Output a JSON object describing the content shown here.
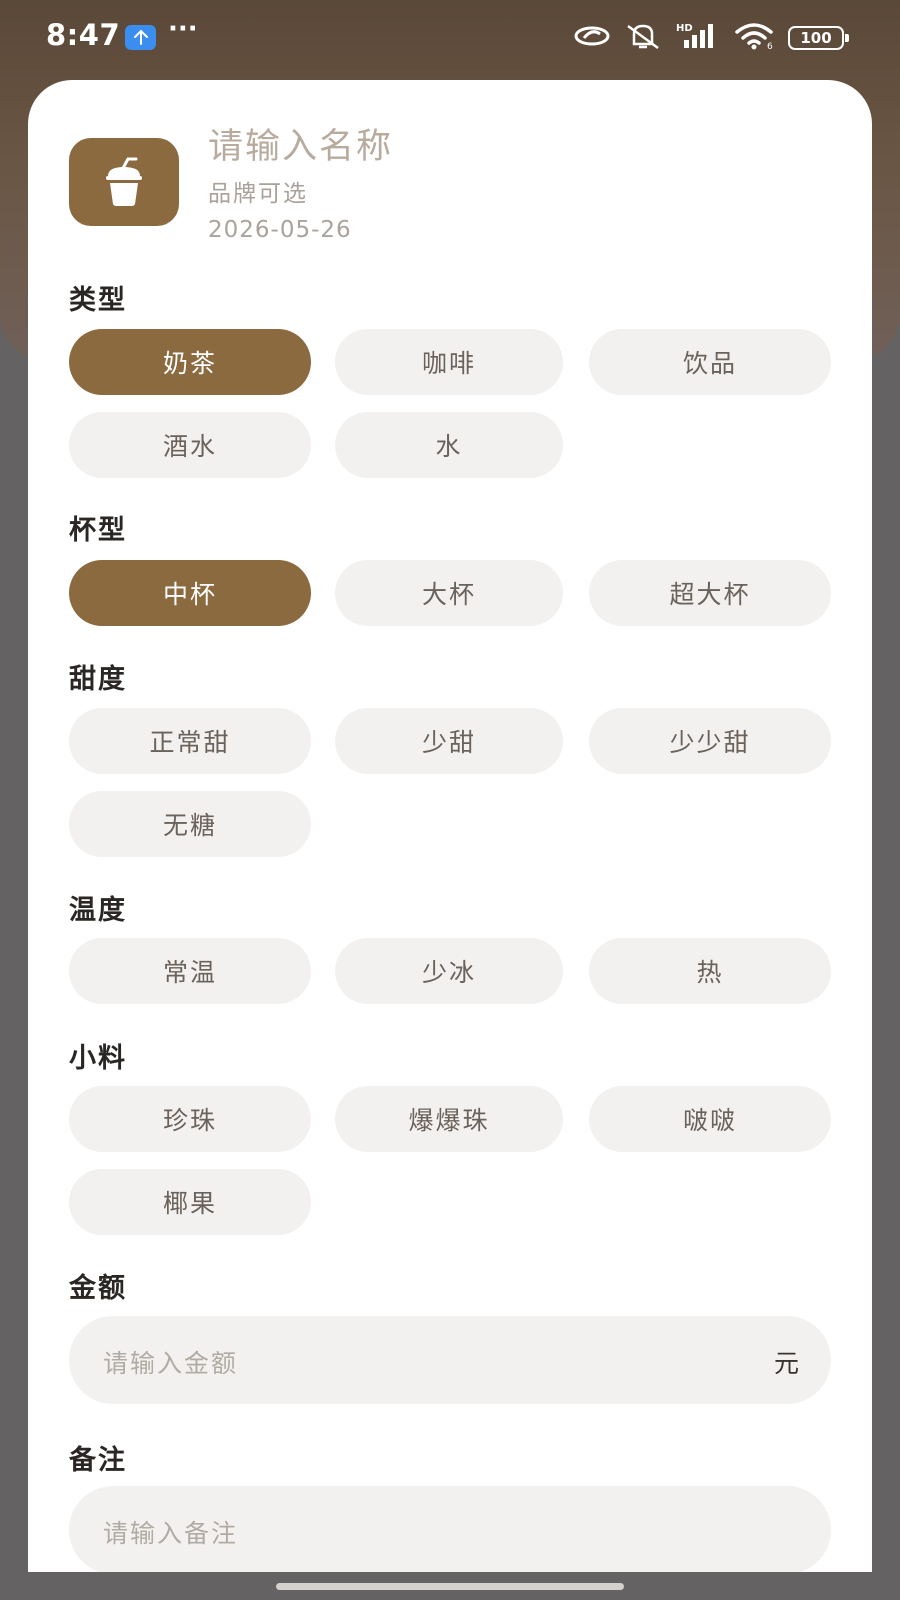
{
  "status_bar": {
    "time": "8:47",
    "dots": "···",
    "battery": "100",
    "icons": [
      "upload-notification-icon",
      "link-icon",
      "bell-muted-icon",
      "hd-signal-icon",
      "wifi-icon",
      "battery-icon"
    ]
  },
  "header": {
    "name_placeholder": "请输入名称",
    "brand_placeholder": "品牌可选",
    "date": "2026-05-26",
    "icon": "drink-cup-icon",
    "accent_color": "#8c6a40"
  },
  "sections": {
    "type": {
      "title": "类型",
      "options": [
        "奶茶",
        "咖啡",
        "饮品",
        "酒水",
        "水"
      ],
      "selected": "奶茶"
    },
    "cup": {
      "title": "杯型",
      "options": [
        "中杯",
        "大杯",
        "超大杯"
      ],
      "selected": "中杯"
    },
    "sweetness": {
      "title": "甜度",
      "options": [
        "正常甜",
        "少甜",
        "少少甜",
        "无糖"
      ],
      "selected": ""
    },
    "temperature": {
      "title": "温度",
      "options": [
        "常温",
        "少冰",
        "热"
      ],
      "selected": ""
    },
    "toppings": {
      "title": "小料",
      "options": [
        "珍珠",
        "爆爆珠",
        "啵啵",
        "椰果"
      ],
      "selected": ""
    }
  },
  "amount": {
    "title": "金额",
    "placeholder": "请输入金额",
    "unit": "元"
  },
  "note": {
    "title": "备注",
    "placeholder": "请输入备注"
  }
}
